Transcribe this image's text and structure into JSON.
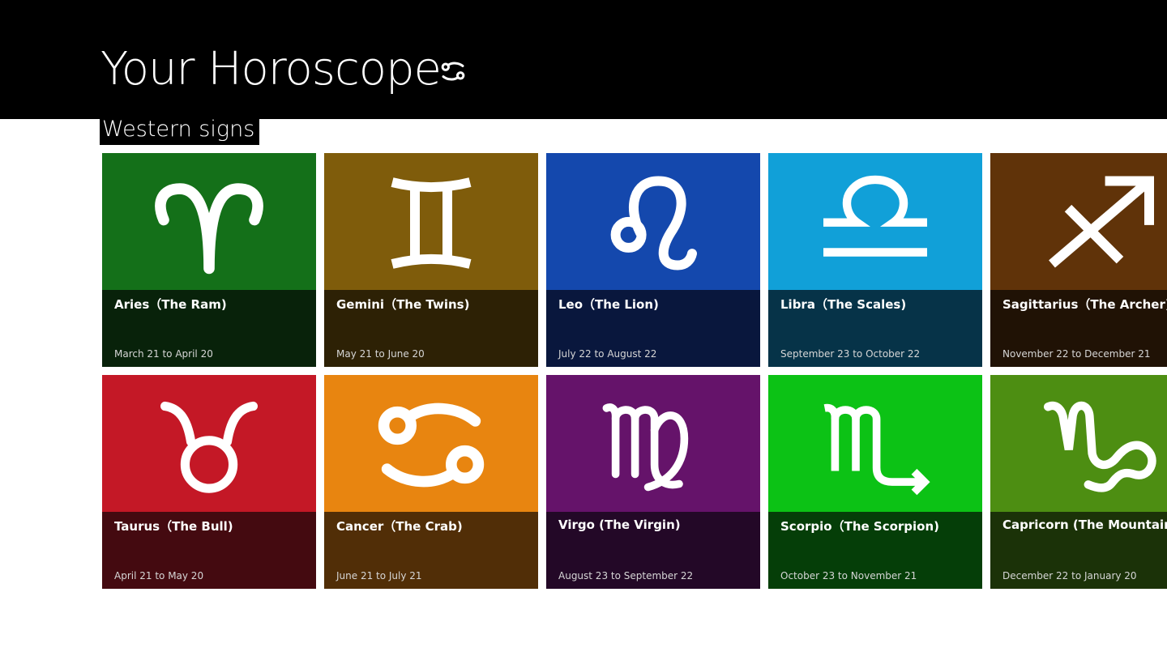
{
  "header": {
    "title": "Your Horoscope",
    "title_icon": "cancer-icon"
  },
  "section": {
    "label": "Western signs"
  },
  "tiles": [
    {
      "name": "Aries（The Ram)",
      "dates": "March 21 to April 20",
      "icon": "aries-icon",
      "color": "#147019",
      "dark": "#08220a"
    },
    {
      "name": "Gemini（The Twins)",
      "dates": "May 21 to June 20",
      "icon": "gemini-icon",
      "color": "#7f5c0b",
      "dark": "#2d2105"
    },
    {
      "name": "Leo（The Lion)",
      "dates": "July 22 to August 22",
      "icon": "leo-icon",
      "color": "#1448ad",
      "dark": "#09173d"
    },
    {
      "name": "Libra（The Scales)",
      "dates": "September 23 to October 22",
      "icon": "libra-icon",
      "color": "#11a0d8",
      "dark": "#063348"
    },
    {
      "name": "Sagittarius（The Archer)",
      "dates": "November 22 to December 21",
      "icon": "sagittarius-icon",
      "color": "#603309",
      "dark": "#201205"
    },
    {
      "name": "Taurus（The Bull)",
      "dates": "April 21 to May 20",
      "icon": "taurus-icon",
      "color": "#c41826",
      "dark": "#440a10"
    },
    {
      "name": "Cancer（The Crab)",
      "dates": "June 21 to July 21",
      "icon": "cancer-icon",
      "color": "#e88510",
      "dark": "#512e07"
    },
    {
      "name": "Virgo (The Virgin)",
      "dates": "August 23 to September 22",
      "icon": "virgo-icon",
      "color": "#65136a",
      "dark": "#230827"
    },
    {
      "name": "Scorpio（The Scorpion)",
      "dates": "October 23 to November 21",
      "icon": "scorpio-icon",
      "color": "#0cc215",
      "dark": "#053e08"
    },
    {
      "name": "Capricorn (The Mountain-goat)",
      "dates": "December 22 to January 20",
      "icon": "capricorn-icon",
      "color": "#4d8e12",
      "dark": "#1b3208"
    }
  ]
}
